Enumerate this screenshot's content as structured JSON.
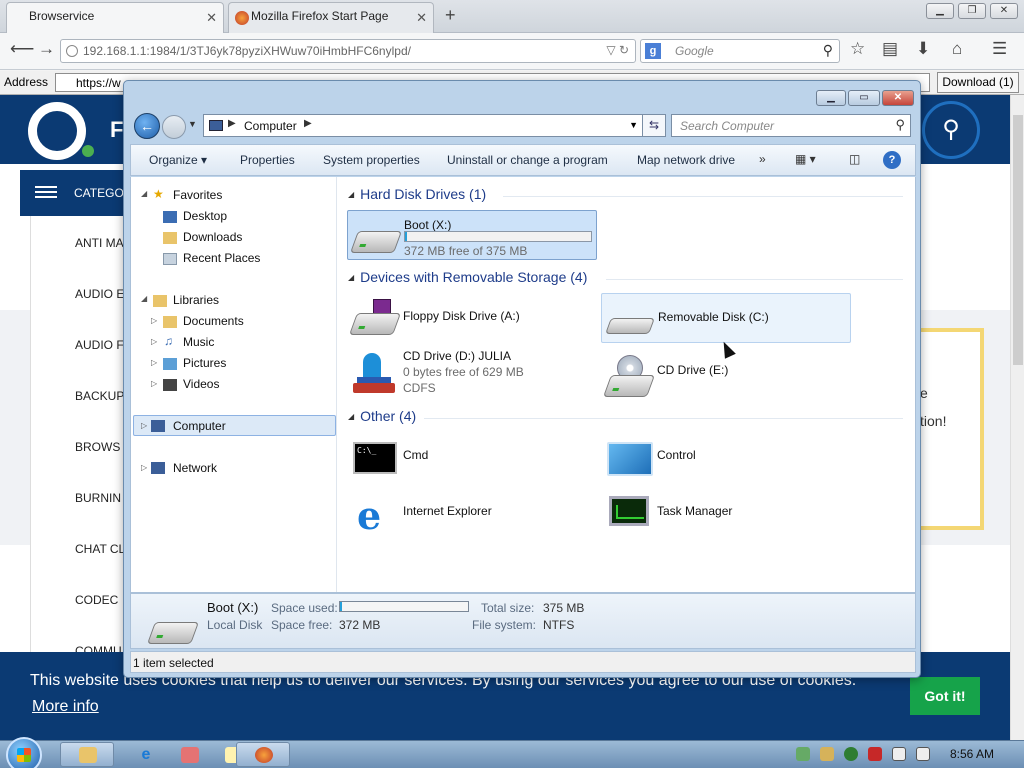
{
  "browser": {
    "tabs": [
      {
        "label": "Browservice",
        "active": true
      },
      {
        "label": "Mozilla Firefox Start Page",
        "active": false
      }
    ],
    "url": "192.168.1.1:1984/1/3TJ6yk78pyziXHWuw70iHmbHFC6nylpd/",
    "search_placeholder": "Google",
    "address_label": "Address",
    "address_value": "https://w",
    "download_label": "Download (1)"
  },
  "website": {
    "categories_label": "CATEGOR",
    "categories": [
      "ANTI MA",
      "AUDIO E",
      "AUDIO F",
      "BACKUP",
      "BROWS",
      "BURNIN",
      "CHAT CL",
      "CODEC",
      "COMMU"
    ],
    "side_text_1": "e",
    "side_text_2": "tion!",
    "cookie_message": "This website uses cookies that help us to deliver our services. By using our services you agree to our use of cookies.",
    "cookie_more": "More info",
    "cookie_ok": "Got it!"
  },
  "explorer": {
    "breadcrumb": "Computer",
    "search_placeholder": "Search Computer",
    "commands": [
      "Organize",
      "Properties",
      "System properties",
      "Uninstall or change a program",
      "Map network drive"
    ],
    "nav": {
      "favorites": "Favorites",
      "favorites_items": [
        "Desktop",
        "Downloads",
        "Recent Places"
      ],
      "libraries": "Libraries",
      "libraries_items": [
        "Documents",
        "Music",
        "Pictures",
        "Videos"
      ],
      "computer": "Computer",
      "network": "Network"
    },
    "groups": {
      "hdd": "Hard Disk Drives (1)",
      "removable": "Devices with Removable Storage (4)",
      "other": "Other (4)"
    },
    "hdd": {
      "name": "Boot (X:)",
      "free": "372 MB free of 375 MB",
      "used_fraction": 0.01
    },
    "removable": [
      {
        "name": "Floppy Disk Drive (A:)"
      },
      {
        "name": "Removable Disk (C:)"
      },
      {
        "name": "CD Drive (D:) JULIA",
        "free": "0 bytes free of 629 MB",
        "fs": "CDFS"
      },
      {
        "name": "CD Drive (E:)"
      }
    ],
    "other": [
      {
        "name": "Cmd"
      },
      {
        "name": "Control"
      },
      {
        "name": "Internet Explorer"
      },
      {
        "name": "Task Manager"
      }
    ],
    "details": {
      "name": "Boot (X:)",
      "type": "Local Disk",
      "space_used_label": "Space used:",
      "space_free_label": "Space free:",
      "space_free": "372 MB",
      "total_size_label": "Total size:",
      "total_size": "375 MB",
      "fs_label": "File system:",
      "fs": "NTFS",
      "used_fraction": 0.01
    },
    "status": "1 item selected"
  },
  "taskbar": {
    "clock": "8:56 AM"
  }
}
